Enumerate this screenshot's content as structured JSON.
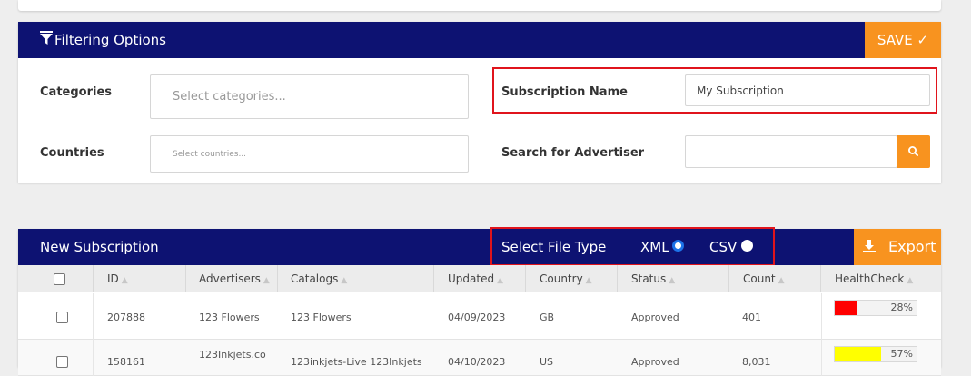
{
  "filter": {
    "title": "Filtering Options",
    "save_label": "SAVE ✓",
    "categories_label": "Categories",
    "categories_placeholder": "Select categories...",
    "countries_label": "Countries",
    "countries_placeholder": "Select countries...",
    "subscription_label": "Subscription Name",
    "subscription_value": "My Subscription",
    "advertiser_label": "Search for Advertiser",
    "advertiser_value": ""
  },
  "subscription": {
    "title": "New Subscription",
    "file_type_label": "Select File Type",
    "xml_label": "XML",
    "csv_label": "CSV",
    "selected_type": "XML",
    "export_label": "Export"
  },
  "table": {
    "columns": [
      "ID",
      "Advertisers",
      "Catalogs",
      "Updated",
      "Country",
      "Status",
      "Count",
      "HealthCheck"
    ],
    "rows": [
      {
        "id": "207888",
        "advertiser": "123 Flowers",
        "catalog": "123 Flowers",
        "updated": "04/09/2023",
        "country": "GB",
        "status": "Approved",
        "count": "401",
        "health_pct": "28%",
        "health_value": 28,
        "health_color": "#ff0000"
      },
      {
        "id": "158161",
        "advertiser": "123Inkjets.co",
        "catalog": "123inkjets-Live 123Inkjets",
        "updated": "04/10/2023",
        "country": "US",
        "status": "Approved",
        "count": "8,031",
        "health_pct": "57%",
        "health_value": 57,
        "health_color": "#ffff00"
      }
    ]
  },
  "colors": {
    "header": "#0d1272",
    "accent": "#f8931f",
    "highlight": "#e0141c"
  }
}
